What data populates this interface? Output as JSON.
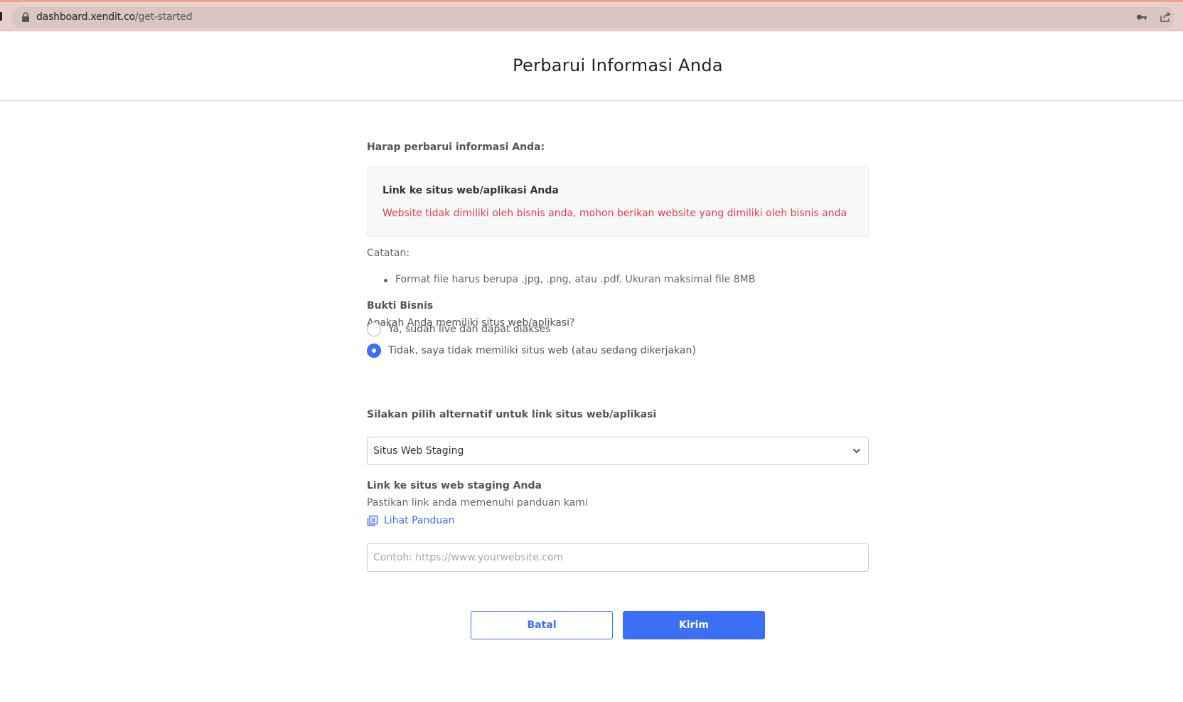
{
  "browser": {
    "url_domain": "dashboard.xendit.co",
    "url_path": "/get-started"
  },
  "header": {
    "title": "Perbarui Informasi Anda"
  },
  "form": {
    "intro": "Harap perbarui informasi Anda:",
    "card": {
      "title": "Link ke situs web/aplikasi Anda",
      "error": "Website tidak dimiliki oleh bisnis anda, mohon berikan website yang dimiliki oleh bisnis anda"
    },
    "note_label": "Catatan:",
    "notes": [
      "Format file harus berupa .jpg, .png, atau .pdf. Ukuran maksimal file 8MB"
    ],
    "section_title": "Bukti Bisnis",
    "question": "Apakah Anda memiliki situs web/aplikasi?",
    "radio_options": [
      {
        "label": "Ya, sudah live dan dapat diakses",
        "checked": false
      },
      {
        "label": "Tidak, saya tidak memiliki situs web (atau sedang dikerjakan)",
        "checked": true
      }
    ],
    "alt_title": "Silakan pilih alternatif untuk link situs web/aplikasi",
    "select_value": "Situs Web Staging",
    "link_title": "Link ke situs web staging Anda",
    "link_desc": "Pastikan link anda memenuhi panduan kami",
    "guide_link": "Lihat Panduan",
    "url_placeholder": "Contoh: https://www.yourwebsite.com",
    "url_value": ""
  },
  "buttons": {
    "cancel": "Batal",
    "submit": "Kirim"
  },
  "colors": {
    "accent": "#3b6ff5",
    "error": "#e03e4f"
  }
}
